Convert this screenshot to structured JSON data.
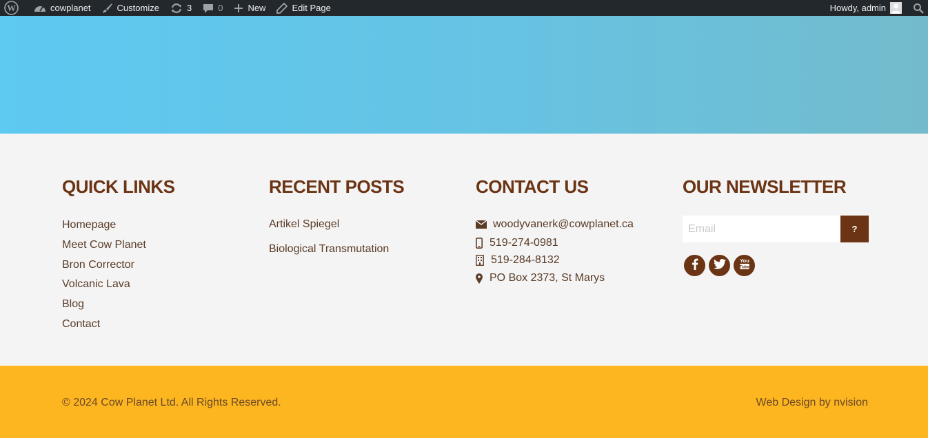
{
  "adminbar": {
    "site_name": "cowplanet",
    "customize": "Customize",
    "updates_count": "3",
    "comments_count": "0",
    "new_label": "New",
    "edit_page": "Edit Page",
    "howdy": "Howdy, admin"
  },
  "footer": {
    "quick_links": {
      "title": "QUICK LINKS",
      "items": [
        "Homepage",
        "Meet Cow Planet",
        "Bron Corrector",
        "Volcanic Lava",
        "Blog",
        "Contact"
      ]
    },
    "recent_posts": {
      "title": "RECENT POSTS",
      "items": [
        "Artikel Spiegel",
        "Biological Transmutation"
      ]
    },
    "contact": {
      "title": "CONTACT US",
      "email": "woodyvanerk@cowplanet.ca",
      "mobile": "519-274-0981",
      "office": "519-284-8132",
      "address": "PO Box 2373, St Marys"
    },
    "newsletter": {
      "title": "OUR NEWSLETTER",
      "email_placeholder": "Email",
      "submit_label": "?"
    }
  },
  "bottom": {
    "copyright": "© 2024 Cow Planet Ltd. All Rights Reserved.",
    "credit": "Web Design by nvision"
  },
  "colors": {
    "brand_brown": "#6b3414",
    "footer_yellow": "#fdb520",
    "hero_blue": "#5ec9f1",
    "adminbar_bg": "#23282d"
  },
  "icons": [
    "wordpress-icon",
    "dashboard-icon",
    "brush-icon",
    "refresh-icon",
    "comment-icon",
    "plus-icon",
    "pencil-icon",
    "search-icon",
    "envelope-icon",
    "mobile-icon",
    "building-icon",
    "map-marker-icon",
    "facebook-icon",
    "twitter-icon",
    "youtube-icon"
  ]
}
